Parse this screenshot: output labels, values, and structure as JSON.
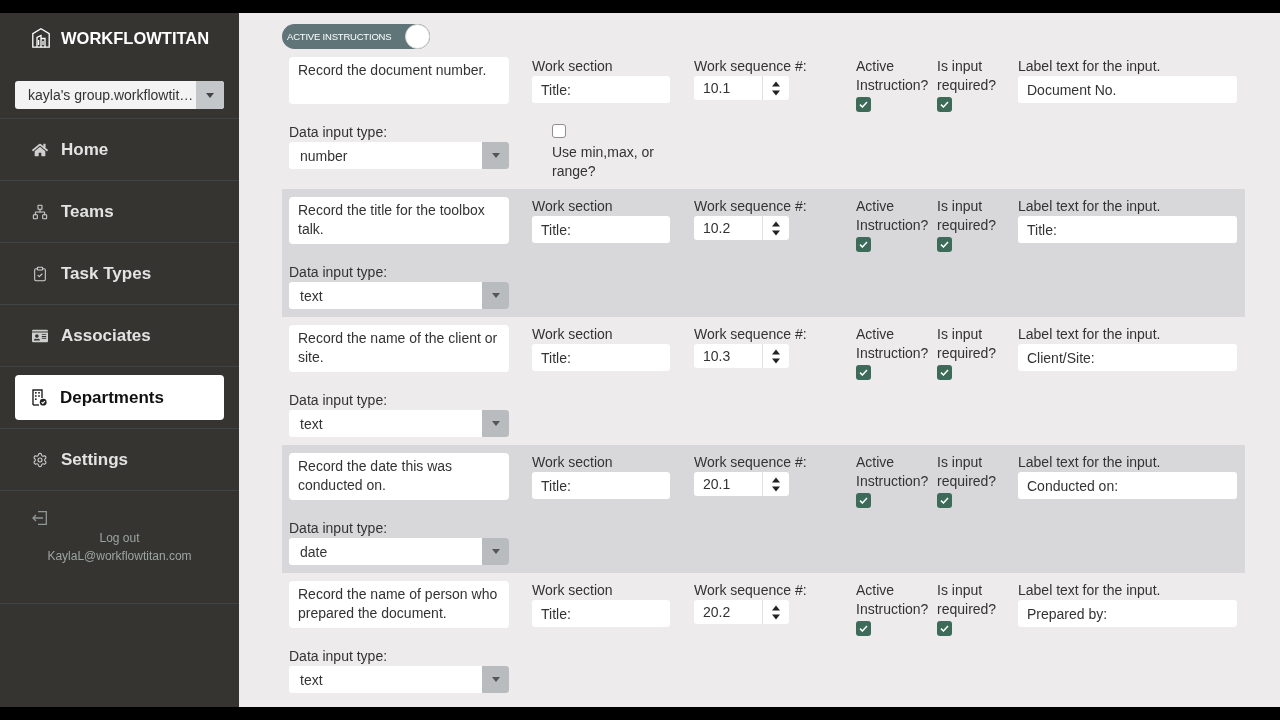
{
  "brand": {
    "name": "WORKFLOWTITAN"
  },
  "group_select": {
    "value": "kayla's group.workflowtit…"
  },
  "nav": [
    {
      "label": "Home",
      "selected": false
    },
    {
      "label": "Teams",
      "selected": false
    },
    {
      "label": "Task Types",
      "selected": false
    },
    {
      "label": "Associates",
      "selected": false
    },
    {
      "label": "Departments",
      "selected": true
    },
    {
      "label": "Settings",
      "selected": false
    }
  ],
  "account": {
    "logout": "Log out",
    "email": "KaylaL@workflowtitan.com"
  },
  "toggle": {
    "label": "ACTIVE INSTRUCTIONS",
    "on": true
  },
  "instructions": [
    {
      "instruction": "Record the document number.",
      "work_section_label": "Work section",
      "work_section": "Title:",
      "sequence_label": "Work sequence #:",
      "sequence": "10.1",
      "active_label": "Active Instruction?",
      "active": true,
      "required_label": "Is input required?",
      "required": true,
      "input_label_label": "Label text for the input.",
      "input_label": "Document No.",
      "data_type_label": "Data input type:",
      "data_type": "number",
      "range_option": {
        "label": "Use min,max, or range?",
        "checked": false
      }
    },
    {
      "instruction": "Record the title for the toolbox talk.",
      "work_section_label": "Work section",
      "work_section": "Title:",
      "sequence_label": "Work sequence #:",
      "sequence": "10.2",
      "active_label": "Active Instruction?",
      "active": true,
      "required_label": "Is input required?",
      "required": true,
      "input_label_label": "Label text for the input.",
      "input_label": "Title:",
      "data_type_label": "Data input type:",
      "data_type": "text"
    },
    {
      "instruction": "Record the name of the client or site.",
      "work_section_label": "Work section",
      "work_section": "Title:",
      "sequence_label": "Work sequence #:",
      "sequence": "10.3",
      "active_label": "Active Instruction?",
      "active": true,
      "required_label": "Is input required?",
      "required": true,
      "input_label_label": "Label text for the input.",
      "input_label": "Client/Site:",
      "data_type_label": "Data input type:",
      "data_type": "text"
    },
    {
      "instruction": "Record the date this was conducted on.",
      "work_section_label": "Work section",
      "work_section": "Title:",
      "sequence_label": "Work sequence #:",
      "sequence": "20.1",
      "active_label": "Active Instruction?",
      "active": true,
      "required_label": "Is input required?",
      "required": true,
      "input_label_label": "Label text for the input.",
      "input_label": "Conducted on:",
      "data_type_label": "Data input type:",
      "data_type": "date"
    },
    {
      "instruction": "Record the name of person who prepared the document.",
      "work_section_label": "Work section",
      "work_section": "Title:",
      "sequence_label": "Work sequence #:",
      "sequence": "20.2",
      "active_label": "Active Instruction?",
      "active": true,
      "required_label": "Is input required?",
      "required": true,
      "input_label_label": "Label text for the input.",
      "input_label": "Prepared by:",
      "data_type_label": "Data input type:",
      "data_type": "text"
    }
  ]
}
